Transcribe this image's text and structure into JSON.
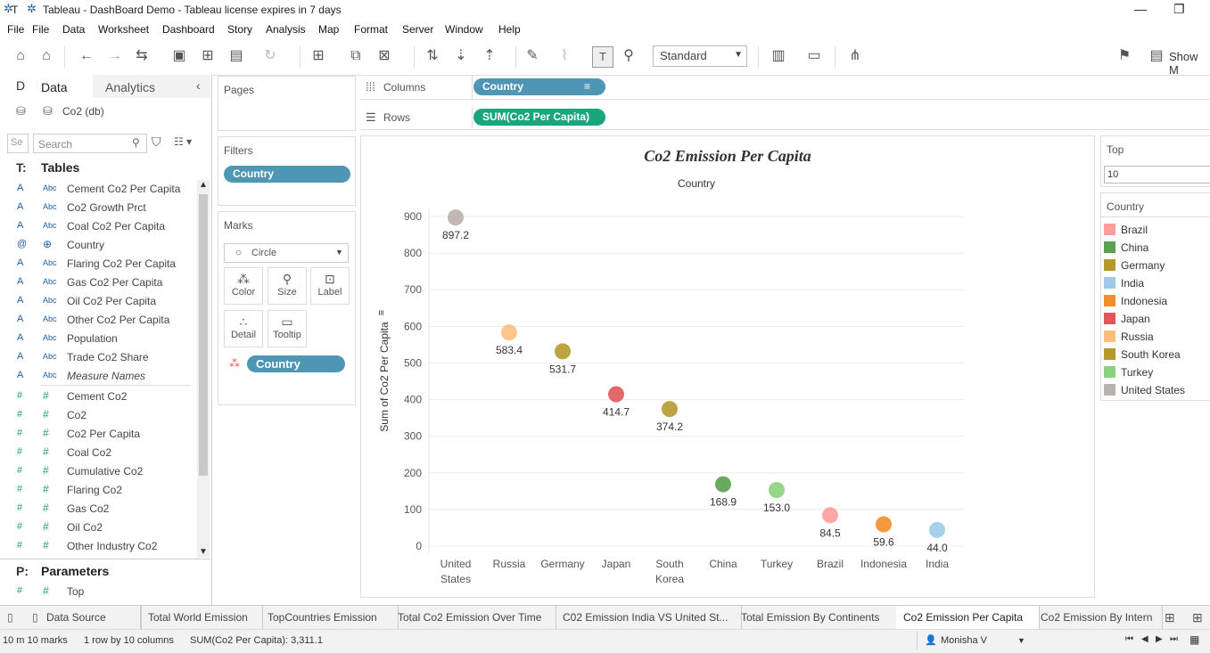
{
  "window": {
    "title": "Tableau - DashBoard Demo - Tableau license expires in 7 days",
    "tab_short": "T"
  },
  "menu": [
    "File",
    "File",
    "Data",
    "Worksheet",
    "Dashboard",
    "Story",
    "Analysis",
    "Map",
    "Format",
    "Server",
    "Window",
    "Help"
  ],
  "toolbar": {
    "mark_size": "Standard",
    "show_me": "Show M"
  },
  "data_pane": {
    "tab_data_short": "D",
    "tab_data": "Data",
    "tab_analytics": "Analytics",
    "datasource": "Co2 (db)",
    "search_short": "Se",
    "search_placeholder": "Search",
    "tables_short": "T:",
    "tables_header": "Tables",
    "dimensions": [
      {
        "a": "A",
        "type": "Abc",
        "name": "Cement Co2 Per Capita"
      },
      {
        "a": "A",
        "type": "Abc",
        "name": "Co2 Growth Prct"
      },
      {
        "a": "A",
        "type": "Abc",
        "name": "Coal Co2 Per Capita"
      },
      {
        "a": "@",
        "type": "globe",
        "name": "Country"
      },
      {
        "a": "A",
        "type": "Abc",
        "name": "Flaring Co2 Per Capita"
      },
      {
        "a": "A",
        "type": "Abc",
        "name": "Gas Co2 Per Capita"
      },
      {
        "a": "A",
        "type": "Abc",
        "name": "Oil Co2 Per Capita"
      },
      {
        "a": "A",
        "type": "Abc",
        "name": "Other Co2 Per Capita"
      },
      {
        "a": "A",
        "type": "Abc",
        "name": "Population"
      },
      {
        "a": "A",
        "type": "Abc",
        "name": "Trade Co2 Share"
      },
      {
        "a": "A",
        "type": "Abc",
        "name": "Measure Names"
      }
    ],
    "measures": [
      {
        "a": "#",
        "type": "#",
        "name": "Cement Co2"
      },
      {
        "a": "#",
        "type": "#",
        "name": "Co2"
      },
      {
        "a": "#",
        "type": "#",
        "name": "Co2 Per Capita"
      },
      {
        "a": "#",
        "type": "#",
        "name": "Coal Co2"
      },
      {
        "a": "#",
        "type": "#",
        "name": "Cumulative Co2"
      },
      {
        "a": "#",
        "type": "#",
        "name": "Flaring Co2"
      },
      {
        "a": "#",
        "type": "#",
        "name": "Gas Co2"
      },
      {
        "a": "#",
        "type": "#",
        "name": "Oil Co2"
      },
      {
        "a": "#",
        "type": "#",
        "name": "Other Industry Co2"
      }
    ],
    "params_short": "P:",
    "params_header": "Parameters",
    "params": [
      {
        "a": "#",
        "type": "#",
        "name": "Top"
      }
    ]
  },
  "shelves": {
    "pages": "Pages",
    "filters": "Filters",
    "filter_pill": "Country",
    "marks": "Marks",
    "mark_type": "Circle",
    "mark_buttons": [
      "Color",
      "Size",
      "Label",
      "Detail",
      "Tooltip"
    ],
    "marks_pill": "Country",
    "columns_label": "Columns",
    "columns_pill": "Country",
    "rows_label": "Rows",
    "rows_pill": "SUM(Co2 Per Capita)"
  },
  "right_pane": {
    "param_title": "Top",
    "param_value": "10",
    "legend_title": "Country",
    "legend": [
      {
        "name": "Brazil",
        "color": "#ff9d9a"
      },
      {
        "name": "China",
        "color": "#59a14f"
      },
      {
        "name": "Germany",
        "color": "#b6992d"
      },
      {
        "name": "India",
        "color": "#a0cbe8"
      },
      {
        "name": "Indonesia",
        "color": "#f28e2b"
      },
      {
        "name": "Japan",
        "color": "#e15759"
      },
      {
        "name": "Russia",
        "color": "#ffbe7d"
      },
      {
        "name": "South Korea",
        "color": "#b6992d"
      },
      {
        "name": "Turkey",
        "color": "#8cd17d"
      },
      {
        "name": "United States",
        "color": "#bab0ac"
      }
    ]
  },
  "chart_data": {
    "type": "scatter",
    "title": "Co2 Emission Per Capita",
    "xlabel": "Country",
    "ylabel": "Sum of Co2 Per Capita",
    "ylim": [
      0,
      950
    ],
    "yticks": [
      0,
      100,
      200,
      300,
      400,
      500,
      600,
      700,
      800,
      900
    ],
    "categories": [
      "United\nStates",
      "Russia",
      "Germany",
      "Japan",
      "South\nKorea",
      "China",
      "Turkey",
      "Brazil",
      "Indonesia",
      "India"
    ],
    "values": [
      897.2,
      583.4,
      531.7,
      414.7,
      374.2,
      168.9,
      153.0,
      84.5,
      59.6,
      44.0
    ],
    "labels": [
      "897.2",
      "583.4",
      "531.7",
      "414.7",
      "374.2",
      "168.9",
      "153.0",
      "84.5",
      "59.6",
      "44.0"
    ],
    "colors": [
      "#bab0ac",
      "#ffbe7d",
      "#b6992d",
      "#e15759",
      "#b6992d",
      "#59a14f",
      "#8cd17d",
      "#ff9d9a",
      "#f28e2b",
      "#a0cbe8"
    ],
    "grid": true
  },
  "sheet_tabs": {
    "items": [
      "Data Source",
      "Total World Emission",
      "TopCountries Emission",
      "Total Co2 Emission Over Time",
      "C02 Emission India VS United St...",
      "Total Emission By Continents",
      "Co2 Emission Per Capita",
      "Co2 Emission By Intern"
    ],
    "active": "Co2 Emission Per Capita"
  },
  "status": {
    "marks": "10 m 10 marks",
    "rows": "1 row by 10 columns",
    "sum": "SUM(Co2 Per Capita): 3,311.1",
    "user": "Monisha V"
  }
}
